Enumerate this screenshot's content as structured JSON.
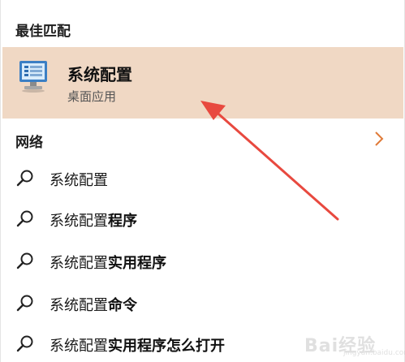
{
  "best_match": {
    "section_title": "最佳匹配",
    "app_name": "系统配置",
    "app_type": "桌面应用",
    "icon": "system-config-icon"
  },
  "network": {
    "section_title": "网络",
    "chevron_icon": "chevron-right-icon"
  },
  "results": [
    {
      "prefix": "系统配置",
      "suffix": ""
    },
    {
      "prefix": "系统配置",
      "suffix": "程序"
    },
    {
      "prefix": "系统配置",
      "suffix": "实用程序"
    },
    {
      "prefix": "系统配置",
      "suffix": "命令"
    },
    {
      "prefix": "系统配置",
      "suffix": "实用程序怎么打开"
    }
  ],
  "watermark": {
    "text": "Bai经验",
    "sub": "jingyan.baidu.com"
  },
  "colors": {
    "highlight": "#f0d8c4",
    "arrow": "#e8493f",
    "chevron": "#e07a38"
  }
}
